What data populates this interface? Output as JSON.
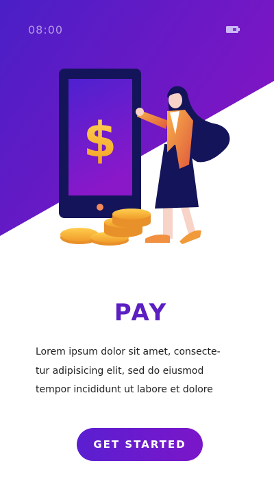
{
  "status_bar": {
    "time": "08:00",
    "battery_icon": "battery-icon"
  },
  "illustration": {
    "phone_symbol": "$",
    "icons": [
      "phone-icon",
      "dollar-icon",
      "coin-stack-icon",
      "woman-figure"
    ]
  },
  "main": {
    "title": "PAY",
    "description_lines": [
      "Lorem ipsum dolor sit amet, consecte-",
      "tur adipisicing elit, sed do eiusmod",
      "tempor incididunt ut labore et dolore"
    ]
  },
  "cta": {
    "label": "GET STARTED"
  },
  "colors": {
    "accent_start": "#4a1fc6",
    "accent_end": "#8414c4",
    "title": "#5b1fc2",
    "coin": "#f5b537"
  }
}
